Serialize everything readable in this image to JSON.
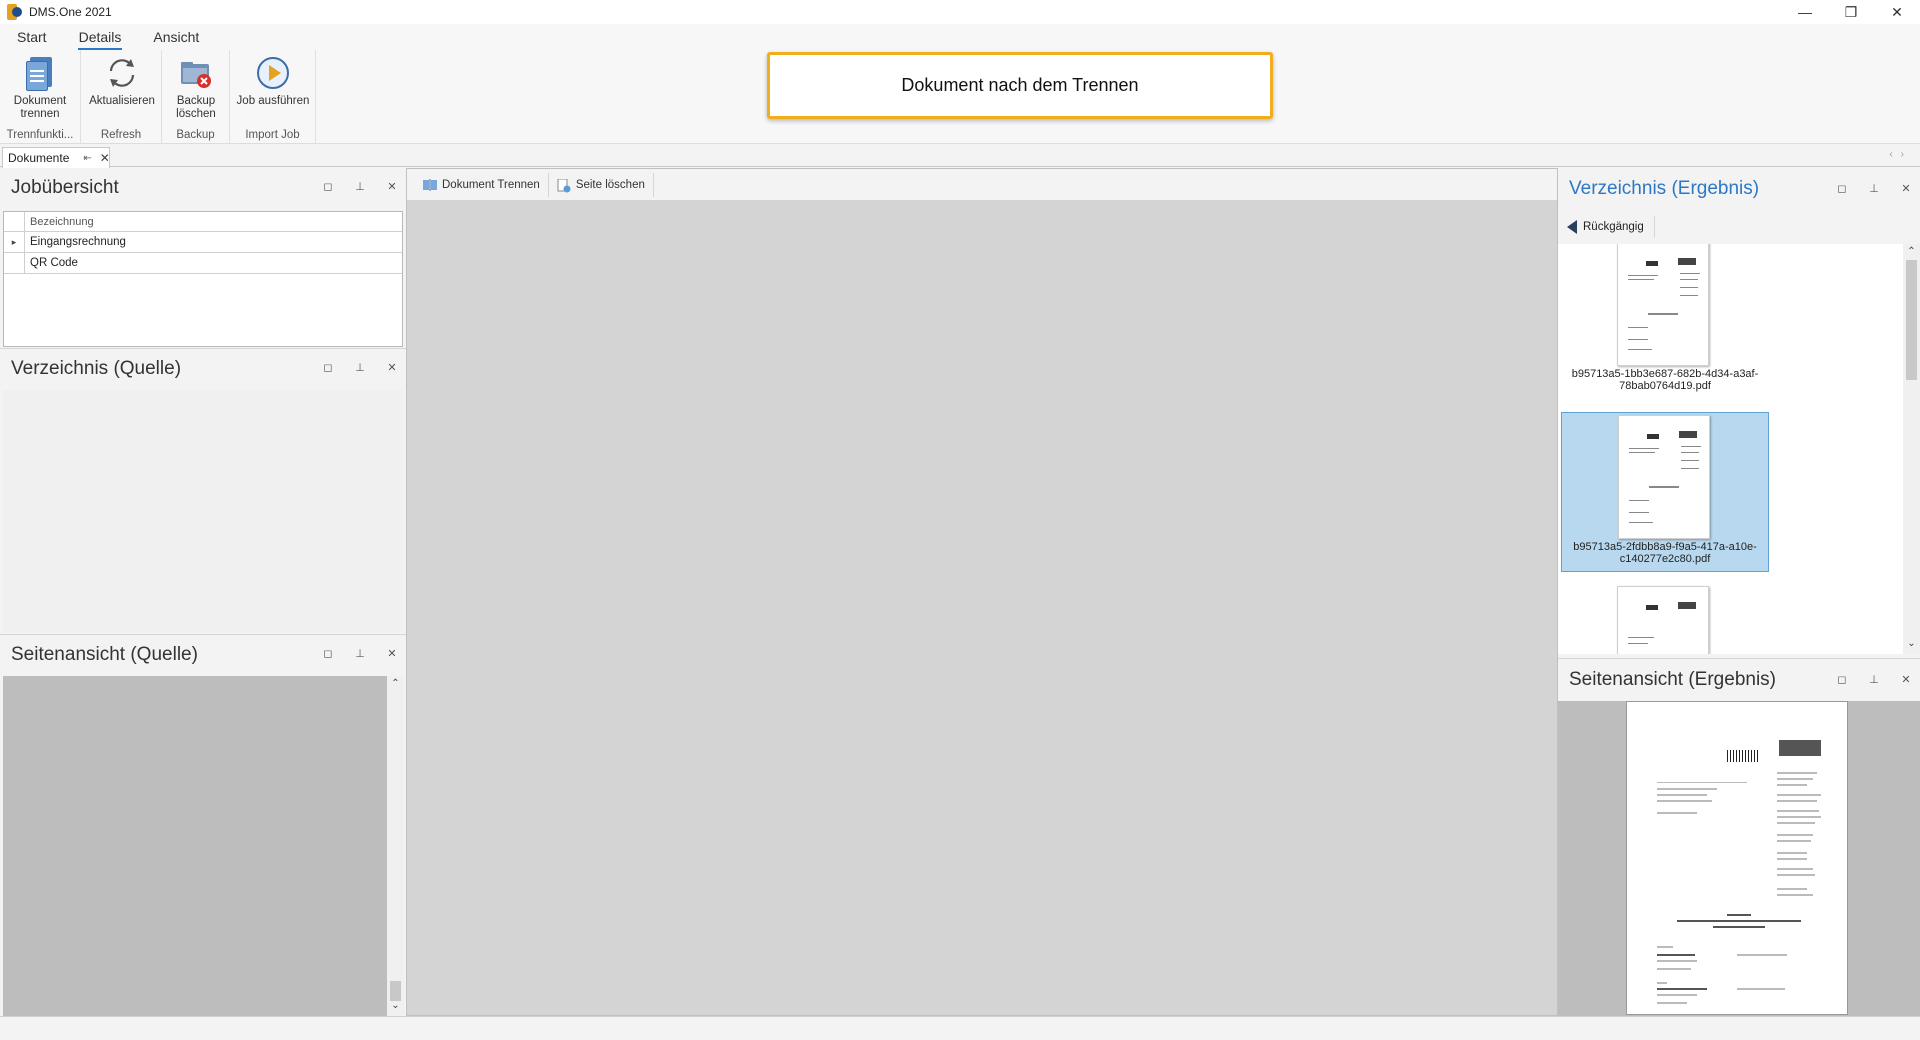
{
  "window": {
    "title": "DMS.One 2021",
    "controls": [
      "—",
      "❐",
      "✕"
    ]
  },
  "ribbon": {
    "tabs": [
      "Start",
      "Details",
      "Ansicht"
    ],
    "active_tab": "Details",
    "groups": [
      {
        "caption": "Trennfunkti...",
        "buttons": [
          {
            "label": "Dokument trennen",
            "icon": "split-document-icon"
          }
        ]
      },
      {
        "caption": "Refresh",
        "buttons": [
          {
            "label": "Aktualisieren",
            "icon": "refresh-icon"
          }
        ]
      },
      {
        "caption": "Backup",
        "buttons": [
          {
            "label": "Backup löschen",
            "icon": "delete-backup-icon"
          }
        ]
      },
      {
        "caption": "Import Job",
        "buttons": [
          {
            "label": "Job ausführen",
            "icon": "play-icon"
          }
        ]
      }
    ]
  },
  "notice": {
    "text": "Dokument nach dem Trennen"
  },
  "document_tab": {
    "label": "Dokumente"
  },
  "panels": {
    "job_overview": {
      "title": "Jobübersicht",
      "column": "Bezeichnung",
      "rows": [
        "Eingangsrechnung",
        "QR Code"
      ]
    },
    "source_directory": {
      "title": "Verzeichnis (Quelle)"
    },
    "source_pageview": {
      "title": "Seitenansicht (Quelle)"
    },
    "result_directory": {
      "title": "Verzeichnis (Ergebnis)",
      "undo_label": "Rückgängig",
      "files": [
        {
          "name": "b95713a5-1bb3e687-682b-4d34-a3af-78bab0764d19.pdf",
          "selected": false
        },
        {
          "name": "b95713a5-2fdbb8a9-f9a5-417a-a10e-c140277e2c80.pdf",
          "selected": true
        },
        {
          "name": "",
          "selected": false
        }
      ]
    },
    "result_pageview": {
      "title": "Seitenansicht (Ergebnis)"
    }
  },
  "center_toolbar": {
    "split_label": "Dokument Trennen",
    "delete_page_label": "Seite löschen"
  },
  "colors": {
    "accent": "#2b79c5",
    "notice_border": "#f2ad1f",
    "selection": "#b8d8ef"
  }
}
